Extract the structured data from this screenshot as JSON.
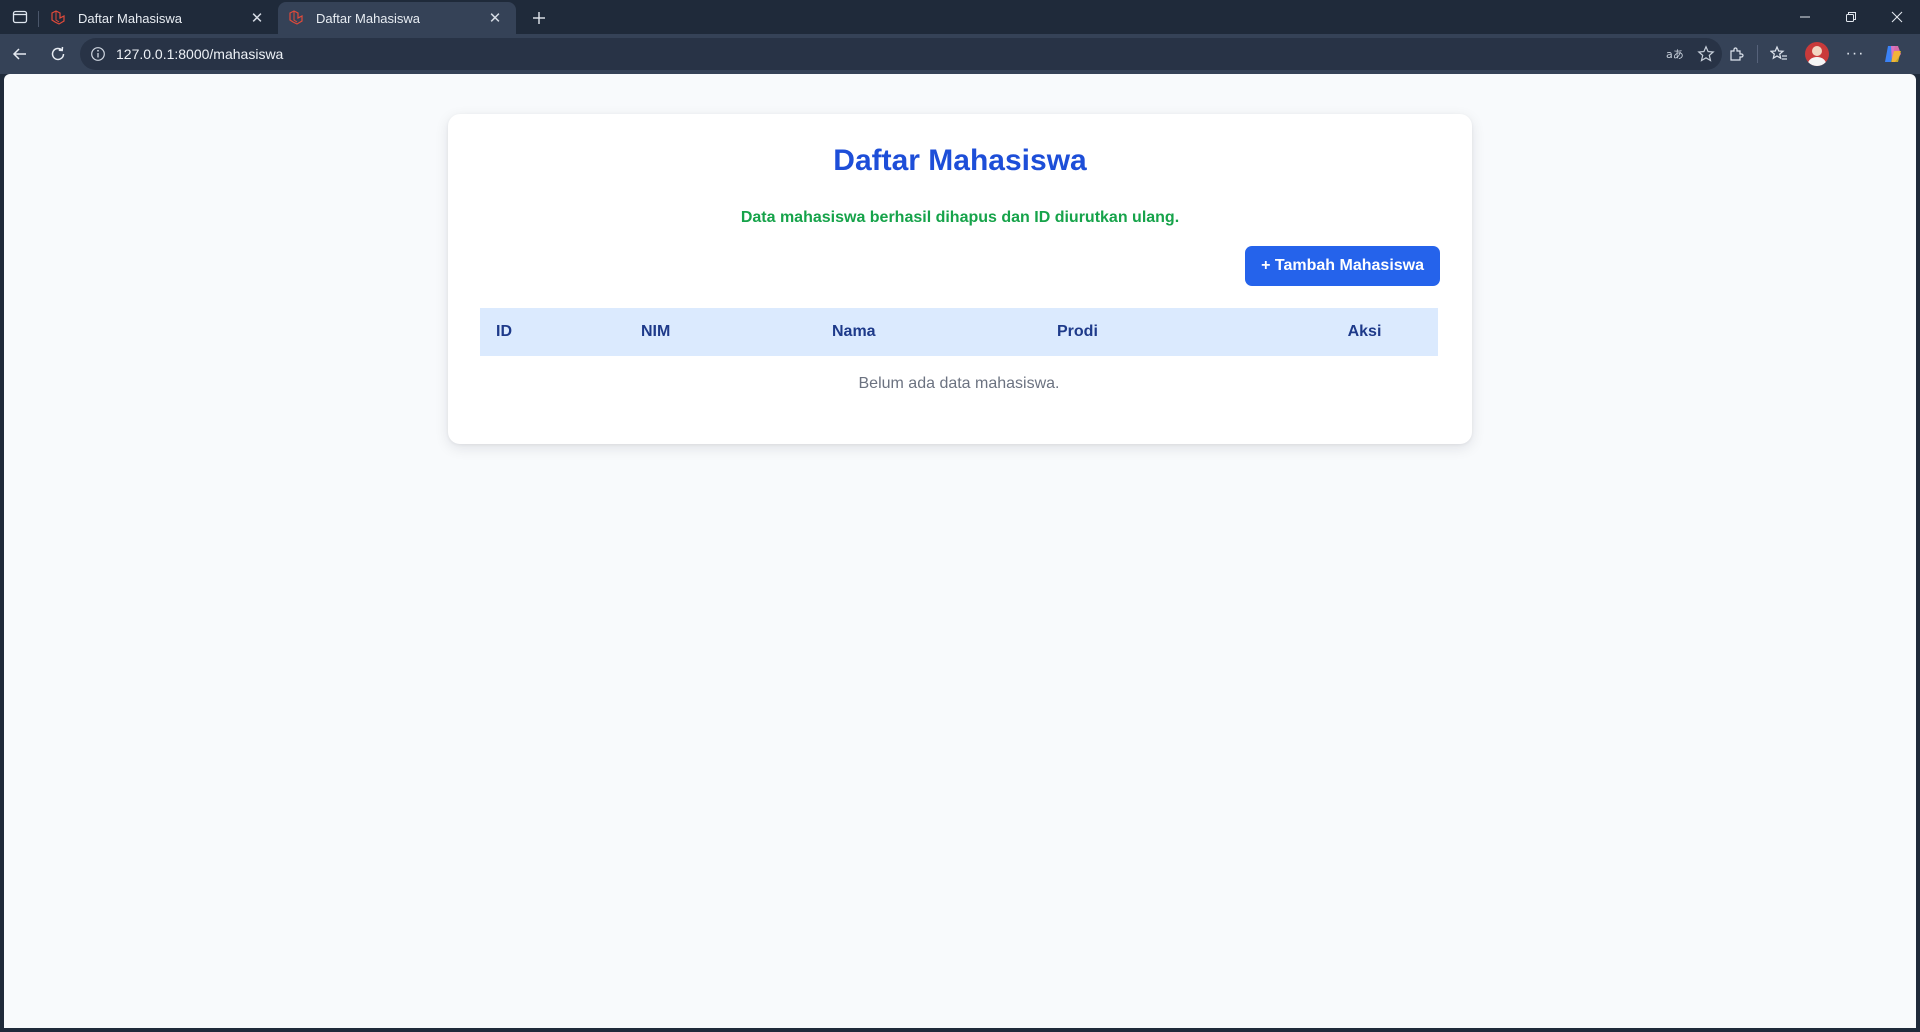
{
  "browser": {
    "tabs": [
      {
        "title": "Daftar Mahasiswa",
        "active": false,
        "close": "✕"
      },
      {
        "title": "Daftar Mahasiswa",
        "active": true,
        "close": "✕"
      }
    ],
    "new_tab": "+",
    "url": "127.0.0.1:8000/mahasiswa",
    "controls": {
      "minimize": "—",
      "restore": "❐",
      "close": "✕"
    },
    "more": "···"
  },
  "page": {
    "title": "Daftar Mahasiswa",
    "flash_message": "Data mahasiswa berhasil dihapus dan ID diurutkan ulang.",
    "add_button_label": "+ Tambah Mahasiswa",
    "table": {
      "columns": [
        "ID",
        "NIM",
        "Nama",
        "Prodi",
        "Aksi"
      ],
      "rows": [],
      "empty_text": "Belum ada data mahasiswa."
    }
  },
  "colors": {
    "accent": "#2563eb",
    "title": "#1d4ed8",
    "success": "#16a34a",
    "table_header_bg": "#dbeafe"
  }
}
